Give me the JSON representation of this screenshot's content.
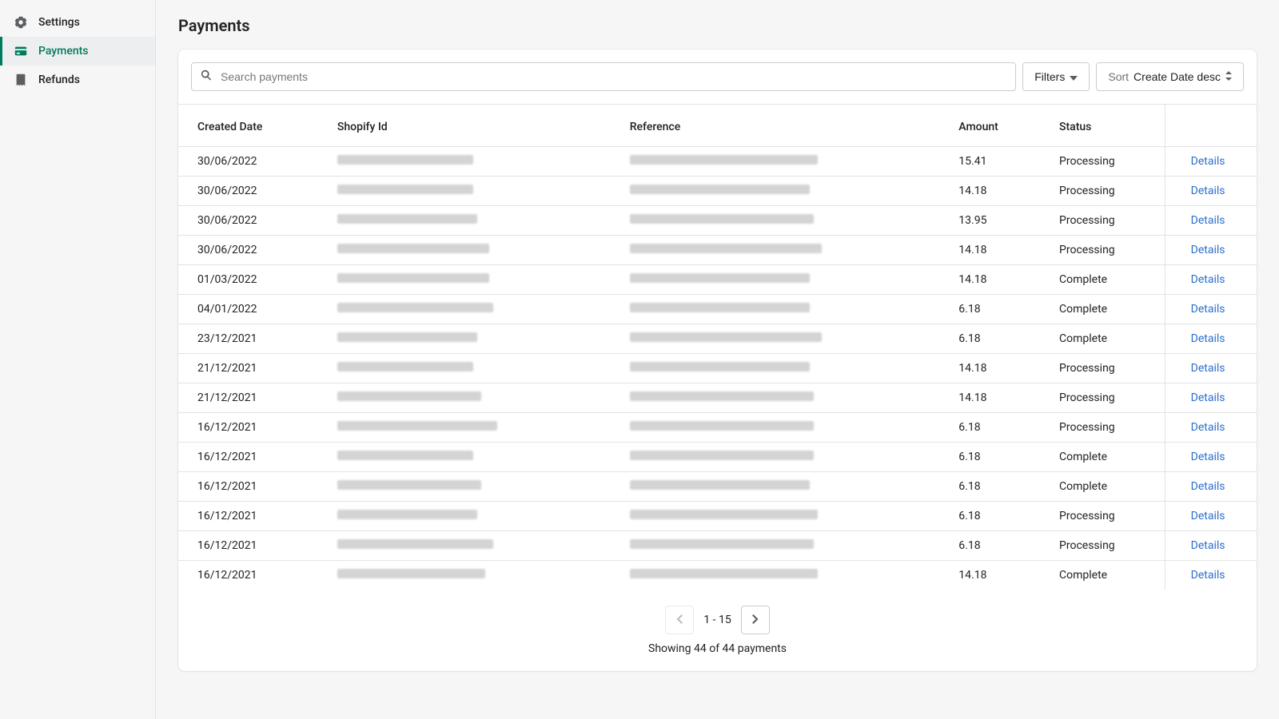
{
  "sidebar": {
    "items": [
      {
        "label": "Settings",
        "active": false
      },
      {
        "label": "Payments",
        "active": true
      },
      {
        "label": "Refunds",
        "active": false
      }
    ]
  },
  "header": {
    "title": "Payments"
  },
  "toolbar": {
    "search_placeholder": "Search payments",
    "filters_label": "Filters",
    "sort_label": "Sort",
    "sort_value": "Create Date desc"
  },
  "table": {
    "columns": [
      "Created Date",
      "Shopify Id",
      "Reference",
      "Amount",
      "Status"
    ],
    "details_label": "Details",
    "rows": [
      {
        "date": "30/06/2022",
        "shopify_w": 170,
        "ref_w": 235,
        "amount": "15.41",
        "status": "Processing"
      },
      {
        "date": "30/06/2022",
        "shopify_w": 170,
        "ref_w": 225,
        "amount": "14.18",
        "status": "Processing"
      },
      {
        "date": "30/06/2022",
        "shopify_w": 175,
        "ref_w": 230,
        "amount": "13.95",
        "status": "Processing"
      },
      {
        "date": "30/06/2022",
        "shopify_w": 190,
        "ref_w": 240,
        "amount": "14.18",
        "status": "Processing"
      },
      {
        "date": "01/03/2022",
        "shopify_w": 190,
        "ref_w": 225,
        "amount": "14.18",
        "status": "Complete"
      },
      {
        "date": "04/01/2022",
        "shopify_w": 195,
        "ref_w": 225,
        "amount": "6.18",
        "status": "Complete"
      },
      {
        "date": "23/12/2021",
        "shopify_w": 175,
        "ref_w": 240,
        "amount": "6.18",
        "status": "Complete"
      },
      {
        "date": "21/12/2021",
        "shopify_w": 170,
        "ref_w": 225,
        "amount": "14.18",
        "status": "Processing"
      },
      {
        "date": "21/12/2021",
        "shopify_w": 180,
        "ref_w": 230,
        "amount": "14.18",
        "status": "Processing"
      },
      {
        "date": "16/12/2021",
        "shopify_w": 200,
        "ref_w": 230,
        "amount": "6.18",
        "status": "Processing"
      },
      {
        "date": "16/12/2021",
        "shopify_w": 170,
        "ref_w": 230,
        "amount": "6.18",
        "status": "Complete"
      },
      {
        "date": "16/12/2021",
        "shopify_w": 180,
        "ref_w": 225,
        "amount": "6.18",
        "status": "Complete"
      },
      {
        "date": "16/12/2021",
        "shopify_w": 175,
        "ref_w": 235,
        "amount": "6.18",
        "status": "Processing"
      },
      {
        "date": "16/12/2021",
        "shopify_w": 195,
        "ref_w": 230,
        "amount": "6.18",
        "status": "Processing"
      },
      {
        "date": "16/12/2021",
        "shopify_w": 185,
        "ref_w": 235,
        "amount": "14.18",
        "status": "Complete"
      }
    ]
  },
  "pagination": {
    "range": "1 - 15",
    "showing": "Showing 44 of 44 payments",
    "prev_disabled": true,
    "next_disabled": false
  }
}
